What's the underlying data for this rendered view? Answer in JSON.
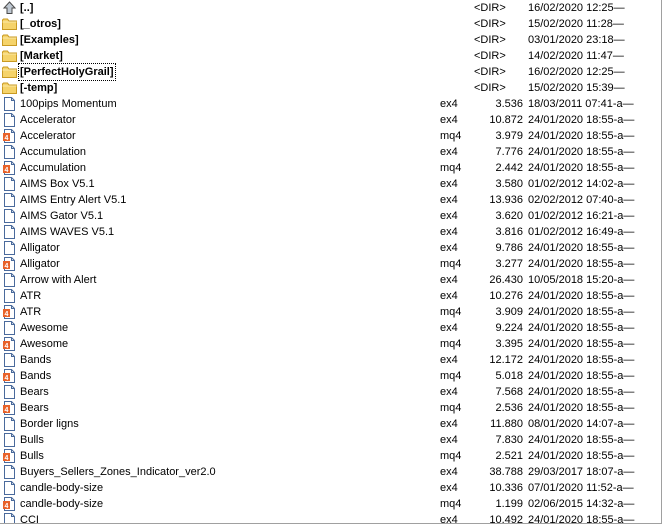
{
  "colors": {
    "folder": "#f5d36a",
    "folder_edge": "#c99a22",
    "doc_edge": "#4a6a9c",
    "mq4_accent": "#e8622a"
  },
  "rows": [
    {
      "type": "up",
      "icon": "up-arrow-icon",
      "name": "[..]",
      "ext": "",
      "size": "<DIR>",
      "date": "16/02/2020 12:25—"
    },
    {
      "type": "dir",
      "icon": "folder-icon",
      "name": "[_otros]",
      "ext": "",
      "size": "<DIR>",
      "date": "15/02/2020 11:28—"
    },
    {
      "type": "dir",
      "icon": "folder-icon",
      "name": "[Examples]",
      "ext": "",
      "size": "<DIR>",
      "date": "03/01/2020 23:18—"
    },
    {
      "type": "dir",
      "icon": "folder-icon",
      "name": "[Market]",
      "ext": "",
      "size": "<DIR>",
      "date": "14/02/2020 11:47—"
    },
    {
      "type": "dir",
      "icon": "folder-icon",
      "name": "[PerfectHolyGrail]",
      "ext": "",
      "size": "<DIR>",
      "date": "16/02/2020 12:25—",
      "focus": true
    },
    {
      "type": "dir",
      "icon": "folder-icon",
      "name": "[-temp]",
      "ext": "",
      "size": "<DIR>",
      "date": "15/02/2020 15:39—"
    },
    {
      "type": "ex4",
      "icon": "document-icon",
      "name": "100pips Momentum",
      "ext": "ex4",
      "size": "3.536",
      "date": "18/03/2011 07:41-a—"
    },
    {
      "type": "ex4",
      "icon": "document-icon",
      "name": "Accelerator",
      "ext": "ex4",
      "size": "10.872",
      "date": "24/01/2020 18:55-a—"
    },
    {
      "type": "mq4",
      "icon": "mq4-file-icon",
      "name": "Accelerator",
      "ext": "mq4",
      "size": "3.979",
      "date": "24/01/2020 18:55-a—"
    },
    {
      "type": "ex4",
      "icon": "document-icon",
      "name": "Accumulation",
      "ext": "ex4",
      "size": "7.776",
      "date": "24/01/2020 18:55-a—"
    },
    {
      "type": "mq4",
      "icon": "mq4-file-icon",
      "name": "Accumulation",
      "ext": "mq4",
      "size": "2.442",
      "date": "24/01/2020 18:55-a—"
    },
    {
      "type": "ex4",
      "icon": "document-icon",
      "name": "AIMS Box V5.1",
      "ext": "ex4",
      "size": "3.580",
      "date": "01/02/2012 14:02-a—"
    },
    {
      "type": "ex4",
      "icon": "document-icon",
      "name": "AIMS Entry Alert V5.1",
      "ext": "ex4",
      "size": "13.936",
      "date": "02/02/2012 07:40-a—"
    },
    {
      "type": "ex4",
      "icon": "document-icon",
      "name": "AIMS Gator V5.1",
      "ext": "ex4",
      "size": "3.620",
      "date": "01/02/2012 16:21-a—"
    },
    {
      "type": "ex4",
      "icon": "document-icon",
      "name": "AIMS WAVES V5.1",
      "ext": "ex4",
      "size": "3.816",
      "date": "01/02/2012 16:49-a—"
    },
    {
      "type": "ex4",
      "icon": "document-icon",
      "name": "Alligator",
      "ext": "ex4",
      "size": "9.786",
      "date": "24/01/2020 18:55-a—"
    },
    {
      "type": "mq4",
      "icon": "mq4-file-icon",
      "name": "Alligator",
      "ext": "mq4",
      "size": "3.277",
      "date": "24/01/2020 18:55-a—"
    },
    {
      "type": "ex4",
      "icon": "document-icon",
      "name": "Arrow with Alert",
      "ext": "ex4",
      "size": "26.430",
      "date": "10/05/2018 15:20-a—"
    },
    {
      "type": "ex4",
      "icon": "document-icon",
      "name": "ATR",
      "ext": "ex4",
      "size": "10.276",
      "date": "24/01/2020 18:55-a—"
    },
    {
      "type": "mq4",
      "icon": "mq4-file-icon",
      "name": "ATR",
      "ext": "mq4",
      "size": "3.909",
      "date": "24/01/2020 18:55-a—"
    },
    {
      "type": "ex4",
      "icon": "document-icon",
      "name": "Awesome",
      "ext": "ex4",
      "size": "9.224",
      "date": "24/01/2020 18:55-a—"
    },
    {
      "type": "mq4",
      "icon": "mq4-file-icon",
      "name": "Awesome",
      "ext": "mq4",
      "size": "3.395",
      "date": "24/01/2020 18:55-a—"
    },
    {
      "type": "ex4",
      "icon": "document-icon",
      "name": "Bands",
      "ext": "ex4",
      "size": "12.172",
      "date": "24/01/2020 18:55-a—"
    },
    {
      "type": "mq4",
      "icon": "mq4-file-icon",
      "name": "Bands",
      "ext": "mq4",
      "size": "5.018",
      "date": "24/01/2020 18:55-a—"
    },
    {
      "type": "ex4",
      "icon": "document-icon",
      "name": "Bears",
      "ext": "ex4",
      "size": "7.568",
      "date": "24/01/2020 18:55-a—"
    },
    {
      "type": "mq4",
      "icon": "mq4-file-icon",
      "name": "Bears",
      "ext": "mq4",
      "size": "2.536",
      "date": "24/01/2020 18:55-a—"
    },
    {
      "type": "ex4",
      "icon": "document-icon",
      "name": "Border ligns",
      "ext": "ex4",
      "size": "11.880",
      "date": "08/01/2020 14:07-a—"
    },
    {
      "type": "ex4",
      "icon": "document-icon",
      "name": "Bulls",
      "ext": "ex4",
      "size": "7.830",
      "date": "24/01/2020 18:55-a—"
    },
    {
      "type": "mq4",
      "icon": "mq4-file-icon",
      "name": "Bulls",
      "ext": "mq4",
      "size": "2.521",
      "date": "24/01/2020 18:55-a—"
    },
    {
      "type": "ex4",
      "icon": "document-icon",
      "name": "Buyers_Sellers_Zones_Indicator_ver2.0",
      "ext": "ex4",
      "size": "38.788",
      "date": "29/03/2017 18:07-a—"
    },
    {
      "type": "ex4",
      "icon": "document-icon",
      "name": "candle-body-size",
      "ext": "ex4",
      "size": "10.336",
      "date": "07/01/2020 11:52-a—"
    },
    {
      "type": "mq4",
      "icon": "mq4-file-icon",
      "name": "candle-body-size",
      "ext": "mq4",
      "size": "1.199",
      "date": "02/06/2015 14:32-a—"
    },
    {
      "type": "ex4",
      "icon": "document-icon",
      "name": "CCI",
      "ext": "ex4",
      "size": "10.492",
      "date": "24/01/2020 18:55-a—"
    }
  ]
}
